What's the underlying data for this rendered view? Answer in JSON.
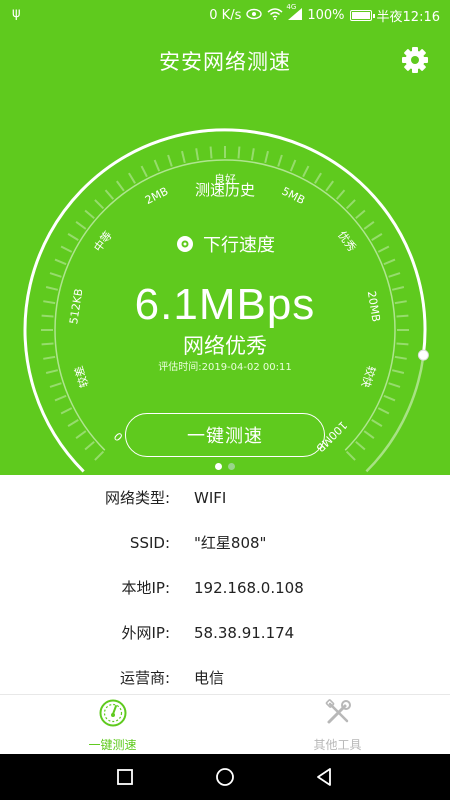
{
  "status_bar": {
    "usb_icon": "usb-icon",
    "net_speed": "0 K/s",
    "signal_badge": "4G",
    "battery_percent": "100%",
    "time": "半夜12:16"
  },
  "header": {
    "title": "安安网络测速",
    "settings_icon": "gear-icon"
  },
  "gauge": {
    "ticks": [
      "0",
      "较差",
      "512KB",
      "中等",
      "2MB",
      "良好",
      "5MB",
      "优秀",
      "20MB",
      "较快",
      "100MB"
    ],
    "level": 0.86,
    "accent": "#5fca1e"
  },
  "history_link": "测速历史",
  "download_label": "下行速度",
  "speed_value": "6.1MBps",
  "quality_label": "网络优秀",
  "eval_time": "评估时间:2019-04-02 00:11",
  "test_button": "一键测速",
  "page_indicator": {
    "count": 2,
    "active": 0
  },
  "info": [
    {
      "key": "网络类型:",
      "value": "WIFI"
    },
    {
      "key": "SSID:",
      "value": "\"红星808\""
    },
    {
      "key": "本地IP:",
      "value": "192.168.0.108"
    },
    {
      "key": "外网IP:",
      "value": "58.38.91.174"
    },
    {
      "key": "运营商:",
      "value": "电信"
    }
  ],
  "tabs": [
    {
      "label": "一键测速",
      "icon": "speedometer-icon",
      "active": true
    },
    {
      "label": "其他工具",
      "icon": "tools-icon",
      "active": false
    }
  ],
  "nav": {
    "recent": "recent-apps-icon",
    "home": "home-icon",
    "back": "back-icon"
  }
}
